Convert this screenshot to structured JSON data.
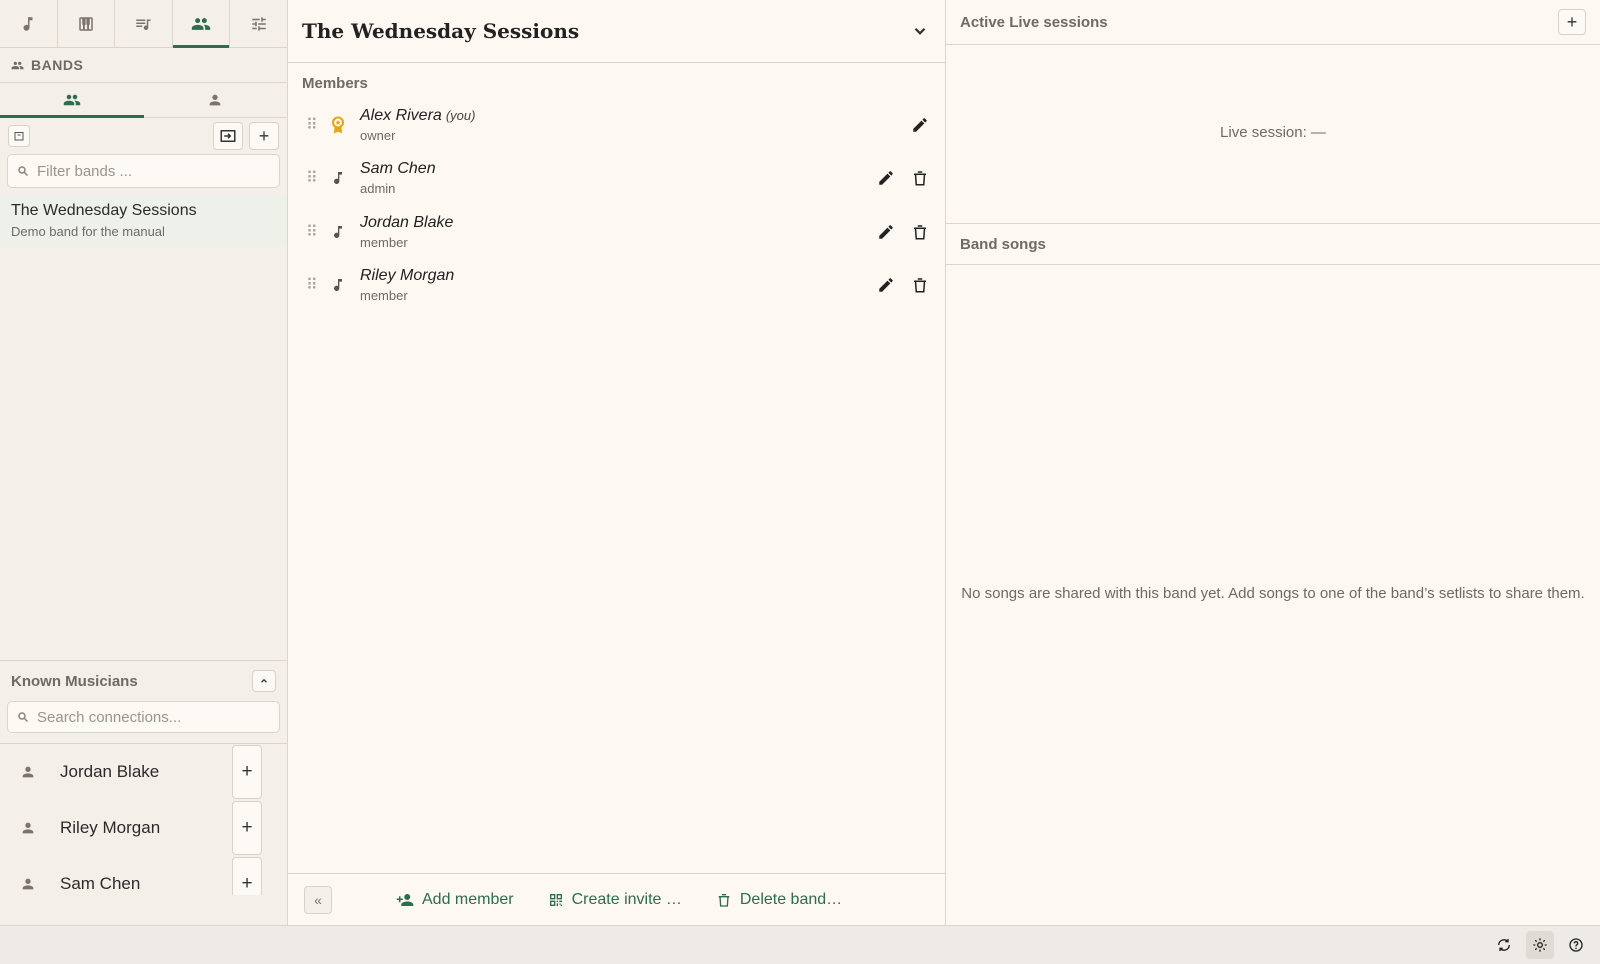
{
  "sidebar": {
    "section_title": "BANDS",
    "filter_placeholder": "Filter bands ...",
    "bands": [
      {
        "name": "The Wednesday Sessions",
        "description": "Demo band for the manual"
      }
    ],
    "known": {
      "title": "Known Musicians",
      "search_placeholder": "Search connections...",
      "musicians": [
        "Jordan Blake",
        "Riley Morgan",
        "Sam Chen"
      ]
    }
  },
  "main": {
    "title": "The Wednesday Sessions",
    "members_label": "Members",
    "members": [
      {
        "name": "Alex Rivera",
        "suffix": "(you)",
        "role": "owner"
      },
      {
        "name": "Sam Chen",
        "role": "admin"
      },
      {
        "name": "Jordan Blake",
        "role": "member"
      },
      {
        "name": "Riley Morgan",
        "role": "member"
      }
    ],
    "footer": {
      "add_member": "Add member",
      "create_invite": "Create invite …",
      "delete_band": "Delete band…"
    }
  },
  "right": {
    "live_title": "Active Live sessions",
    "live_status": "Live session: —",
    "songs_title": "Band songs",
    "songs_empty": "No songs are shared with this band yet. Add songs to one of the band’s setlists to share them."
  },
  "colors": {
    "accent": "#2e6b4f",
    "owner_badge": "#e8a317",
    "background": "#fdf8f1"
  }
}
